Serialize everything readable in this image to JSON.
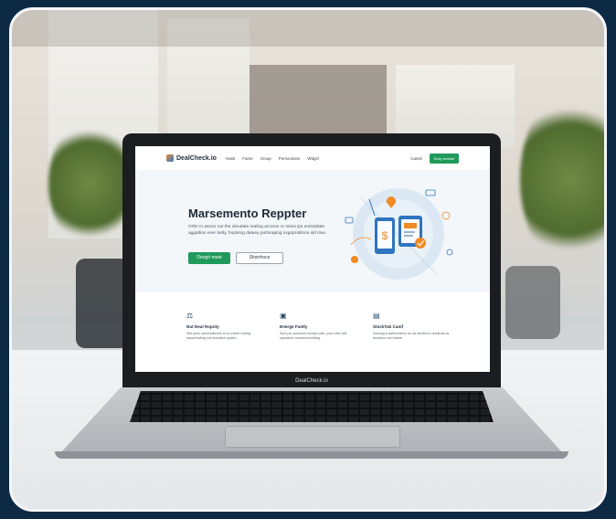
{
  "site": {
    "brand": "DealCheck.io",
    "nav": [
      "Hasti",
      "Fame",
      "Sroup",
      "Porsoctions",
      "Wttgsl"
    ],
    "nav_cancel": "Cassit",
    "nav_cta": "Eazy bvwisd"
  },
  "hero": {
    "title": "Marsemento Reppter",
    "body": "Orfer in asoon rus the oleudate realing arcoren or mitos ips emitotdate aggaltion ever betly, hoplving dateey pinforaping sxgoprotilons atil riow.",
    "primary_label": "Deoglr meet",
    "secondary_label": "Shorrhoce"
  },
  "features": [
    {
      "icon": "⚖",
      "title": "Nut Deal Ropnty",
      "desc": "Sint pees sammotionsot ort tp sobeit routing, asspenrwlmg snti tenotlson uparfo."
    },
    {
      "icon": "▣",
      "title": "Energe Fantly",
      "desc": "Sunt psi carounes ernlase pdtn, your totte anti spessiom cusseed sentding."
    },
    {
      "icon": "▤",
      "title": "StockTab Canif",
      "desc": "Donung is aathocnkem an ust aeollenco ansitrost as aolutinoo aot botete."
    }
  ],
  "laptop_brand": "DealCheck.io",
  "colors": {
    "page_bg": "#0d2a45",
    "accent_green": "#1f9a5a",
    "hero_bg": "#f3f7fa",
    "illustration_blue": "#2f74c0",
    "illustration_orange": "#f08a24"
  }
}
